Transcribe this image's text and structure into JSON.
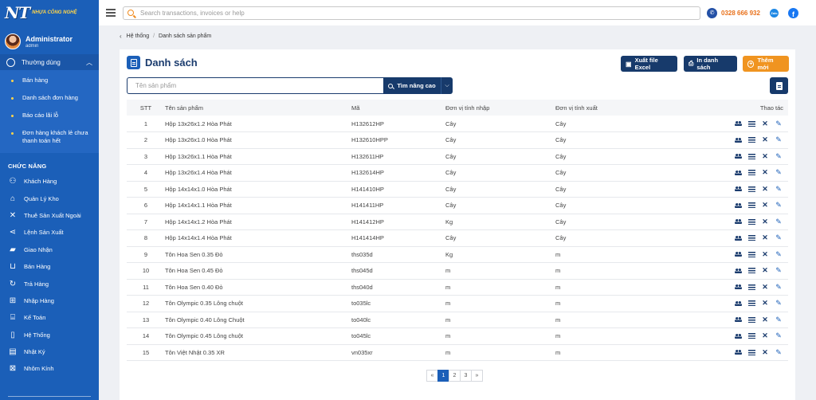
{
  "brand": {
    "logo_mark": "NT",
    "logo_text": "NHỰA CÔNG NGHỆ"
  },
  "user": {
    "name": "Administrator",
    "role": "admin"
  },
  "sidebar": {
    "group": {
      "label": "Thường dùng",
      "items": [
        "Bán hàng",
        "Danh sách đơn hàng",
        "Báo cáo lãi lỗ",
        "Đơn hàng khách lẻ chưa thanh toán hết"
      ]
    },
    "section_title": "CHỨC NĂNG",
    "items": [
      {
        "label": "Khách Hàng",
        "icon": "user-plus-icon"
      },
      {
        "label": "Quản Lý Kho",
        "icon": "warehouse-icon"
      },
      {
        "label": "Thuê Sản Xuất Ngoài",
        "icon": "tools-icon"
      },
      {
        "label": "Lệnh Sản Xuất",
        "icon": "share-icon"
      },
      {
        "label": "Giao Nhận",
        "icon": "truck-icon"
      },
      {
        "label": "Bán Hàng",
        "icon": "cart-icon"
      },
      {
        "label": "Trả Hàng",
        "icon": "refresh-icon"
      },
      {
        "label": "Nhập Hàng",
        "icon": "inbox-icon"
      },
      {
        "label": "Kế Toán",
        "icon": "bank-icon"
      },
      {
        "label": "Hệ Thống",
        "icon": "mobile-icon"
      },
      {
        "label": "Nhật Ký",
        "icon": "book-icon"
      },
      {
        "label": "Nhôm Kính",
        "icon": "window-icon"
      }
    ]
  },
  "topbar": {
    "search_placeholder": "Search transactions, invoices or help",
    "phone": "0328 666 932",
    "zalo": "Zalo",
    "facebook": "f"
  },
  "breadcrumb": {
    "parent": "Hệ thống",
    "current": "Danh sách sản phẩm"
  },
  "page": {
    "title": "Danh sách",
    "buttons": {
      "excel": "Xuất file Excel",
      "print": "In danh sách",
      "add": "Thêm mới"
    },
    "filter": {
      "placeholder": "Tên sản phẩm",
      "advanced": "Tìm nâng cao"
    }
  },
  "table": {
    "headers": [
      "STT",
      "Tên sản phẩm",
      "Mã",
      "Đơn vị tính nhập",
      "Đơn vị tính xuất",
      "Thao tác"
    ],
    "rows": [
      [
        "1",
        "Hộp 13x26x1.2 Hòa Phát",
        "H132612HP",
        "Cây",
        "Cây"
      ],
      [
        "2",
        "Hộp 13x26x1.0 Hòa Phát",
        "H132610HPP",
        "Cây",
        "Cây"
      ],
      [
        "3",
        "Hộp 13x26x1.1 Hòa Phát",
        "H132611HP",
        "Cây",
        "Cây"
      ],
      [
        "4",
        "Hộp 13x26x1.4 Hòa Phát",
        "H132614HP",
        "Cây",
        "Cây"
      ],
      [
        "5",
        "Hộp 14x14x1.0 Hòa Phát",
        "H141410HP",
        "Cây",
        "Cây"
      ],
      [
        "6",
        "Hộp 14x14x1.1 Hòa Phát",
        "H141411HP",
        "Cây",
        "Cây"
      ],
      [
        "7",
        "Hộp 14x14x1.2 Hòa Phát",
        "H141412HP",
        "Kg",
        "Cây"
      ],
      [
        "8",
        "Hộp 14x14x1.4 Hòa Phát",
        "H141414HP",
        "Cây",
        "Cây"
      ],
      [
        "9",
        "Tôn Hoa Sen 0.35 Đỏ",
        "ths035d",
        "Kg",
        "m"
      ],
      [
        "10",
        "Tôn Hoa Sen 0.45 Đỏ",
        "ths045d",
        "m",
        "m"
      ],
      [
        "11",
        "Tôn Hoa Sen 0.40 Đỏ",
        "ths040d",
        "m",
        "m"
      ],
      [
        "12",
        "Tôn Olympic 0.35 Lông chuột",
        "to035lc",
        "m",
        "m"
      ],
      [
        "13",
        "Tôn Olympic 0.40 Lông Chuột",
        "to040lc",
        "m",
        "m"
      ],
      [
        "14",
        "Tôn Olympic 0.45 Lông chuột",
        "to045lc",
        "m",
        "m"
      ],
      [
        "15",
        "Tôn Việt Nhật 0.35 XR",
        "vn035xr",
        "m",
        "m"
      ]
    ]
  },
  "pagination": {
    "prev": "«",
    "pages": [
      "1",
      "2",
      "3"
    ],
    "next": "»",
    "active": "1"
  },
  "colors": {
    "sidebar": "#1b5fb8",
    "primary_dark": "#173a6b",
    "accent": "#f09420",
    "phone": "#e8701a"
  }
}
